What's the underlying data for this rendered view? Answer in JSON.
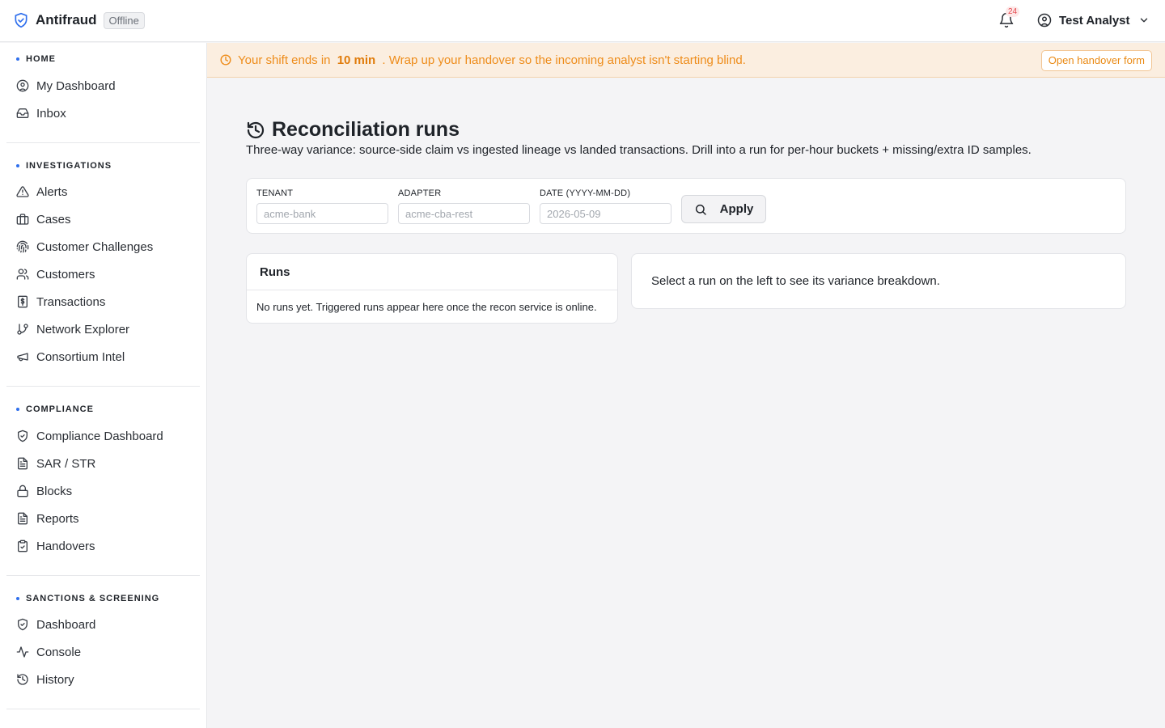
{
  "header": {
    "app_name": "Antifraud",
    "connection_status": "Offline",
    "notifications_count": "24",
    "user_name": "Test Analyst",
    "icons": {
      "logo": "shield-check-icon",
      "notifications": "bell-icon",
      "user": "user-circle-icon",
      "menu": "chevron-down-icon"
    }
  },
  "sidebar": {
    "sections": [
      {
        "label": "HOME",
        "items": [
          {
            "label": "My Dashboard",
            "icon": "user-circle-icon"
          },
          {
            "label": "Inbox",
            "icon": "inbox-icon"
          }
        ]
      },
      {
        "label": "INVESTIGATIONS",
        "items": [
          {
            "label": "Alerts",
            "icon": "alert-triangle-icon"
          },
          {
            "label": "Cases",
            "icon": "briefcase-icon"
          },
          {
            "label": "Customer Challenges",
            "icon": "fingerprint-icon"
          },
          {
            "label": "Customers",
            "icon": "users-icon"
          },
          {
            "label": "Transactions",
            "icon": "receipt-dollar-icon"
          },
          {
            "label": "Network Explorer",
            "icon": "git-branch-icon"
          },
          {
            "label": "Consortium Intel",
            "icon": "megaphone-icon"
          }
        ]
      },
      {
        "label": "COMPLIANCE",
        "items": [
          {
            "label": "Compliance Dashboard",
            "icon": "shield-check-icon"
          },
          {
            "label": "SAR / STR",
            "icon": "file-text-icon"
          },
          {
            "label": "Blocks",
            "icon": "lock-icon"
          },
          {
            "label": "Reports",
            "icon": "file-text-icon"
          },
          {
            "label": "Handovers",
            "icon": "clipboard-check-icon"
          }
        ]
      },
      {
        "label": "SANCTIONS & SCREENING",
        "items": [
          {
            "label": "Dashboard",
            "icon": "shield-check-icon"
          },
          {
            "label": "Console",
            "icon": "activity-icon"
          },
          {
            "label": "History",
            "icon": "history-icon"
          }
        ]
      }
    ]
  },
  "banner": {
    "text_before": "Your shift ends in",
    "time": "10 min",
    "text_after": ". Wrap up your handover so the incoming analyst isn't starting blind.",
    "button_label": "Open handover form",
    "icon": "clock-icon",
    "accent_color": "#ee8c1a"
  },
  "page": {
    "title": "Reconciliation runs",
    "title_icon": "history-icon",
    "subtitle": "Three-way variance: source-side claim vs ingested lineage vs landed transactions. Drill into a run for per-hour buckets + missing/extra ID samples."
  },
  "filters": {
    "tenant": {
      "label": "TENANT",
      "placeholder": "acme-bank",
      "value": ""
    },
    "adapter": {
      "label": "ADAPTER",
      "placeholder": "acme-cba-rest",
      "value": ""
    },
    "date": {
      "label": "DATE (YYYY-MM-DD)",
      "placeholder": "2026-05-09",
      "value": ""
    },
    "apply_label": "Apply",
    "apply_icon": "search-icon"
  },
  "runs": {
    "heading": "Runs",
    "empty_text": "No runs yet. Triggered runs appear here once the recon service is online."
  },
  "detail": {
    "empty_text": "Select a run on the left to see its variance breakdown."
  }
}
